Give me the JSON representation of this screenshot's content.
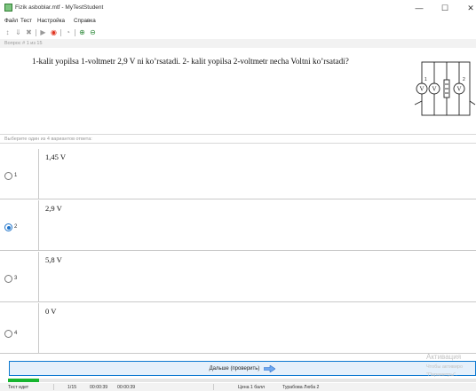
{
  "window": {
    "title": "Fizik asboblar.mtf - MyTestStudent",
    "minimize": "—",
    "maximize": "☐",
    "close": "✕"
  },
  "menu": [
    "Файл",
    "Тест",
    "Настройка",
    "Справка"
  ],
  "question_number": "Вопрос # 1 из 15",
  "question": {
    "text": "1-kalit yopilsa 1-voltmetr 2,9 V  ni ko’rsatadi. 2- kalit yopilsa 2-voltmetr necha Voltni ko’rsatadi?",
    "figure_labels": [
      "V",
      "V",
      "V",
      "1",
      "2"
    ]
  },
  "instruction": "Выберите один из 4 вариантов ответа:",
  "answers": [
    {
      "num": "1",
      "text": "1,45 V",
      "selected": false
    },
    {
      "num": "2",
      "text": "2,9 V",
      "selected": true
    },
    {
      "num": "3",
      "text": "5,8 V",
      "selected": false
    },
    {
      "num": "4",
      "text": "0 V",
      "selected": false
    }
  ],
  "next_button": "Дальше (проверить)",
  "progress": {
    "fraction": 0.0667,
    "color": "#17b52f"
  },
  "status": {
    "state": "Тест идет",
    "count": "1/15",
    "time_elapsed": "00:00:39",
    "time_total": "00:00:39",
    "cost": "Цена 1 балл",
    "user": "Турабова Люба 2"
  },
  "watermark": {
    "title": "Активация",
    "line1": "Чтобы активиро",
    "line2": "\"Параметры\"."
  },
  "colors": {
    "accent": "#1e73c9",
    "button_border": "#0b78d0",
    "button_bg": "#e5f0fb"
  }
}
